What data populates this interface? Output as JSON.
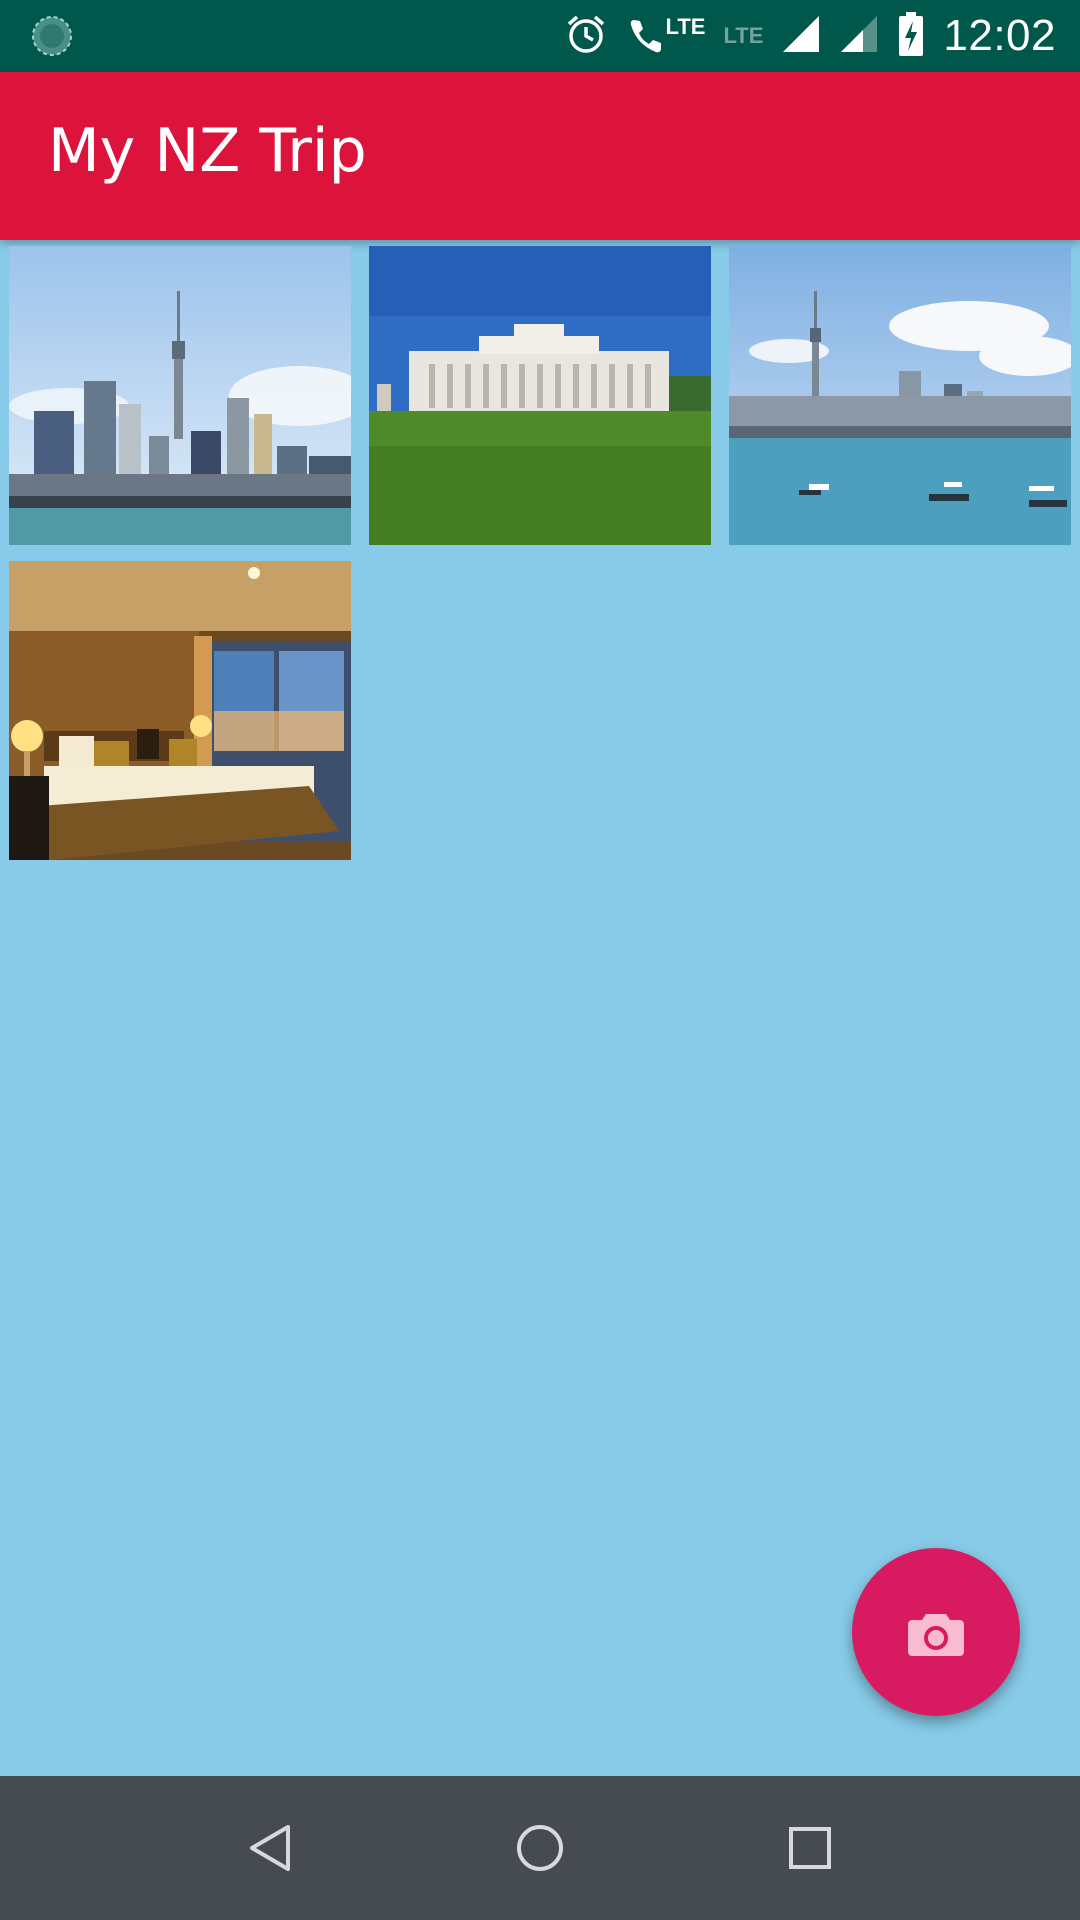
{
  "status_bar": {
    "time": "12:02",
    "network_label": "LTE",
    "network_label_2": "LTE",
    "icons": [
      "sync-icon",
      "alarm-icon",
      "wifi-calling-icon",
      "signal-full-icon",
      "signal-partial-icon",
      "battery-charging-icon"
    ]
  },
  "app_bar": {
    "title": "My NZ Trip"
  },
  "photos": [
    {
      "subject": "city-skyline-harbor"
    },
    {
      "subject": "museum-on-lawn"
    },
    {
      "subject": "city-skyline-with-boats"
    },
    {
      "subject": "hotel-bedroom"
    }
  ],
  "fab": {
    "icon": "camera-icon"
  },
  "nav_bar": {
    "icons": [
      "back-icon",
      "home-icon",
      "recents-icon"
    ]
  },
  "colors": {
    "status_bar": "#00574b",
    "app_bar": "#dc143c",
    "background": "#87cbe8",
    "fab": "#d81b60",
    "nav_bar": "#464b52"
  }
}
